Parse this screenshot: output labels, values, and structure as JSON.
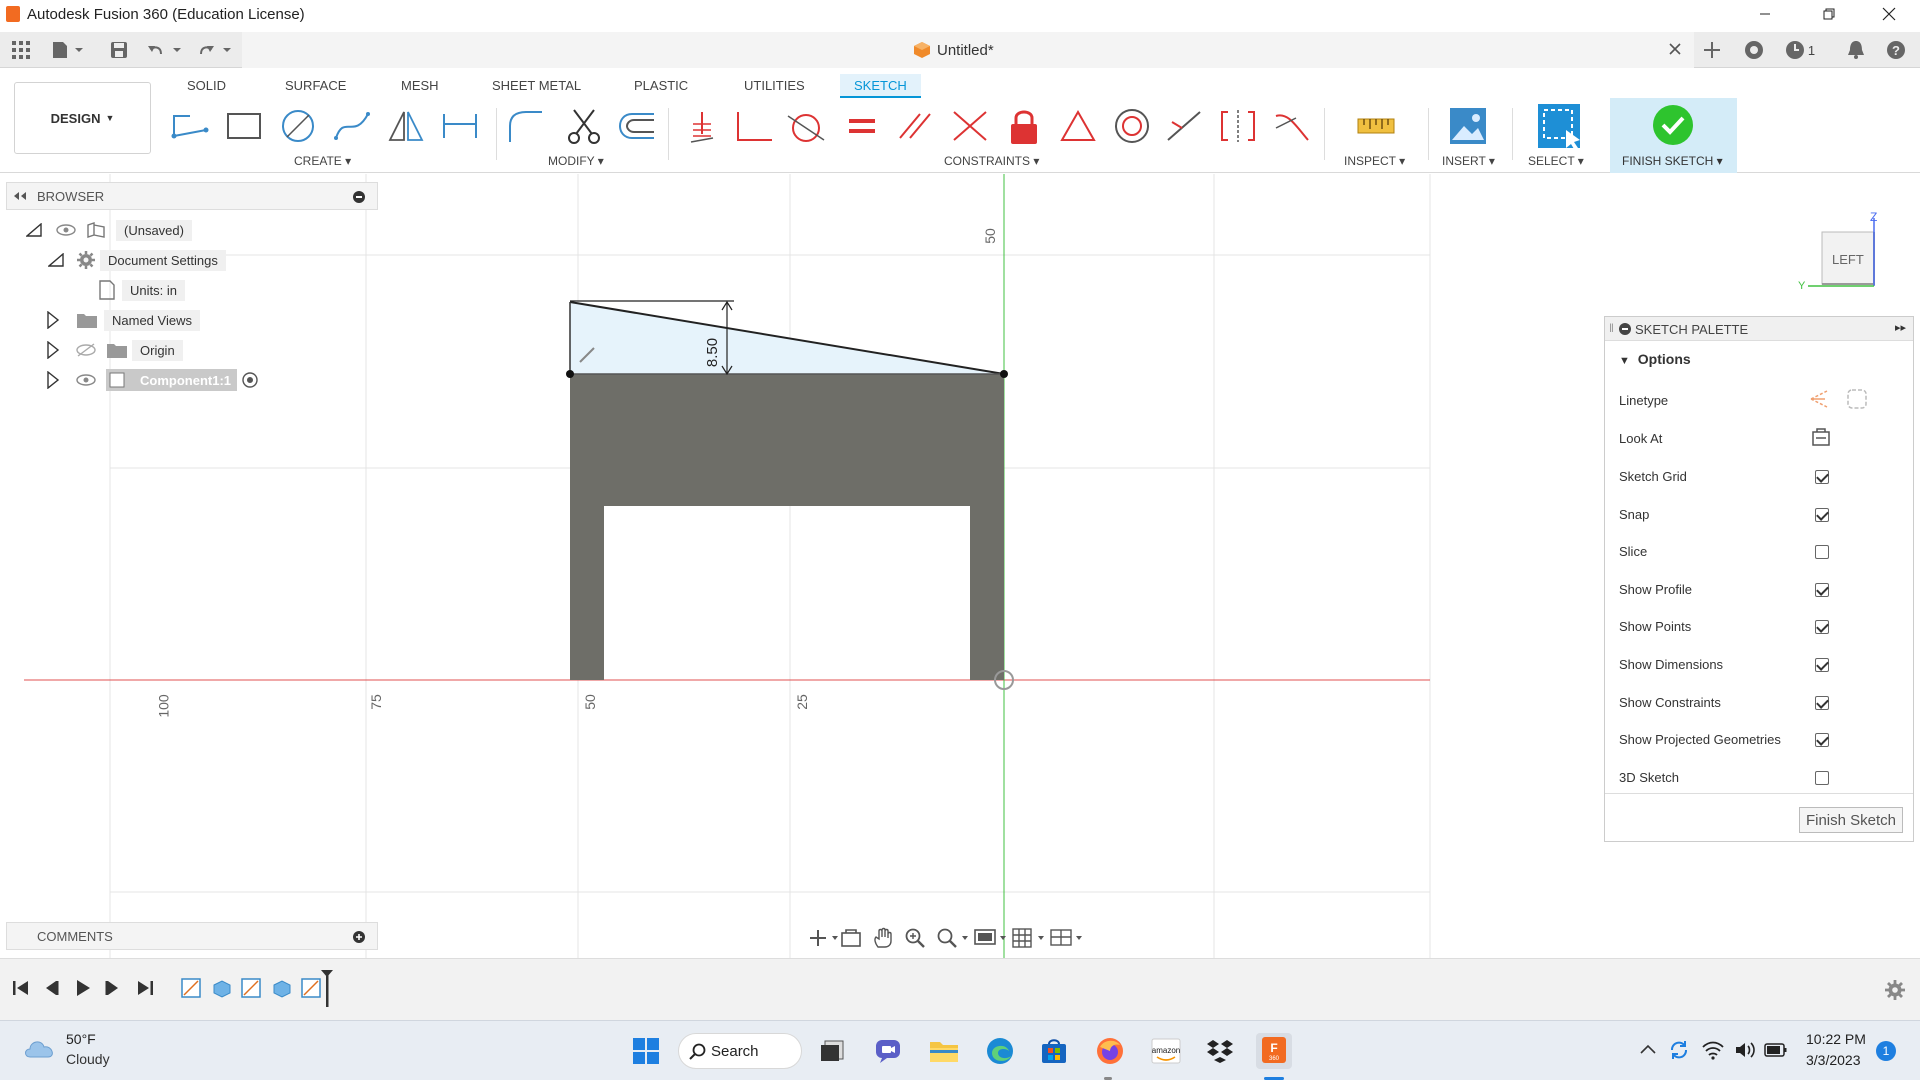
{
  "window": {
    "title": "Autodesk Fusion 360 (Education License)"
  },
  "document": {
    "title": "Untitled*"
  },
  "workspace": {
    "label": "DESIGN"
  },
  "ribbon": {
    "tabs": [
      "SOLID",
      "SURFACE",
      "MESH",
      "SHEET METAL",
      "PLASTIC",
      "UTILITIES",
      "SKETCH"
    ],
    "active_tab": "SKETCH",
    "groups": {
      "create": "CREATE",
      "modify": "MODIFY",
      "constraints": "CONSTRAINTS",
      "inspect": "INSPECT",
      "insert": "INSERT",
      "select": "SELECT",
      "finish": "FINISH SKETCH"
    }
  },
  "browser": {
    "title": "BROWSER",
    "items": [
      {
        "label": "(Unsaved)"
      },
      {
        "label": "Document Settings"
      },
      {
        "label": "Units: in"
      },
      {
        "label": "Named Views"
      },
      {
        "label": "Origin"
      },
      {
        "label": "Component1:1"
      }
    ]
  },
  "comments": {
    "title": "COMMENTS"
  },
  "canvas": {
    "axis_labels_x": [
      "100",
      "75",
      "50",
      "25"
    ],
    "axis_label_y": "50",
    "dimension": "8.50",
    "viewcube": {
      "face": "LEFT",
      "axis_z": "Z",
      "axis_y": "Y"
    }
  },
  "palette": {
    "title": "SKETCH PALETTE",
    "section": "Options",
    "linetype_label": "Linetype",
    "lookat_label": "Look At",
    "options": [
      {
        "label": "Sketch Grid",
        "checked": true
      },
      {
        "label": "Snap",
        "checked": true
      },
      {
        "label": "Slice",
        "checked": false
      },
      {
        "label": "Show Profile",
        "checked": true
      },
      {
        "label": "Show Points",
        "checked": true
      },
      {
        "label": "Show Dimensions",
        "checked": true
      },
      {
        "label": "Show Constraints",
        "checked": true
      },
      {
        "label": "Show Projected Geometries",
        "checked": true
      },
      {
        "label": "3D Sketch",
        "checked": false
      }
    ],
    "finish_button": "Finish Sketch"
  },
  "toolbar": {
    "notifications_count": "1"
  },
  "taskbar": {
    "weather_temp": "50°F",
    "weather_desc": "Cloudy",
    "search_label": "Search",
    "time": "10:22 PM",
    "date": "3/3/2023",
    "badge": "1"
  },
  "colors": {
    "accent": "#0696d7",
    "profile_fill": "#6e6e68",
    "x_axis": "#e05050",
    "y_axis": "#40c040"
  }
}
